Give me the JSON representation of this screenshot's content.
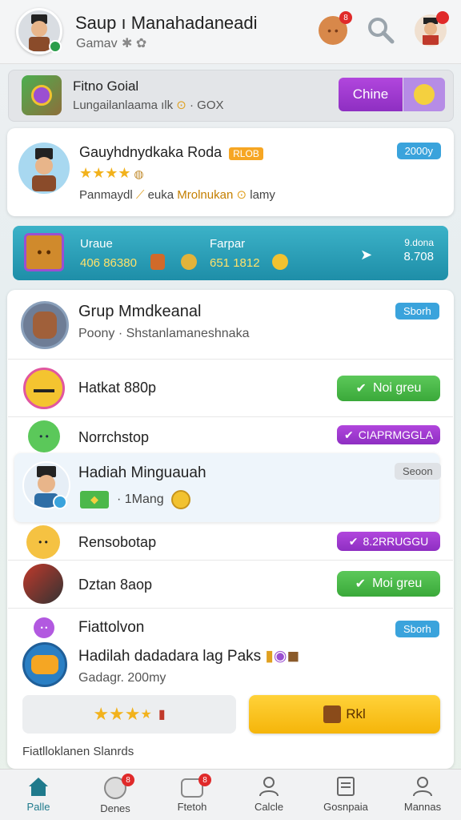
{
  "header": {
    "title": "Saup ı Manahadaneadi",
    "subtitle": "Gamav",
    "colors": {
      "accent": "#2a9d4a",
      "badge": "#e02a2a"
    },
    "notification_count": "8"
  },
  "promo": {
    "title": "Fitno Goial",
    "subtitle": "Lungailanlaama ılk",
    "subtitle_suffix": "· GOX",
    "button_label": "Chine"
  },
  "featured": {
    "title": "Gauyhdnydkaka Roda",
    "tag": "RLOB",
    "badge": "2000y",
    "desc_prefix": "Panmaydl",
    "desc_mid": "euka",
    "desc_highlight": "Mrolnukan",
    "desc_suffix": "lamy"
  },
  "stats": {
    "left_label": "Uraue",
    "left_value": "406 86380",
    "mid_label": "Farpar",
    "mid_value": "651 1812",
    "right_label": "9.dona",
    "right_value": "8.708"
  },
  "group": {
    "title": "Grup Mmdkeanal",
    "subtitle": "Poony · Shstanlamaneshnaka",
    "badge": "Sborh"
  },
  "rows": [
    {
      "label": "Hatkat 880p",
      "action": "Noi greu",
      "type": "green"
    },
    {
      "label": "Norrchstop",
      "action": "CIAPRMGGLA",
      "type": "purple"
    },
    {
      "label": "Hadiah Minguauah",
      "sub": "· 1Mang",
      "badge": "Seoon",
      "type": "highlight"
    },
    {
      "label": "Rensobotap",
      "action": "8.2RRUGGU",
      "type": "purple"
    },
    {
      "label": "Dztan 8aop",
      "action": "Moi greu",
      "type": "green"
    }
  ],
  "bottom_card": {
    "title": "Fiattolvon",
    "badge": "Sborh",
    "pack_title": "Hadilah dadadara lag Paks",
    "pack_sub": "Gadagr. 200my",
    "rate_button": "",
    "cta_label": "Rkl"
  },
  "footer_label": "Fiatlloklanen Slanrds",
  "bottom_nav": [
    {
      "label": "Palle",
      "icon": "home-icon",
      "active": true
    },
    {
      "label": "Denes",
      "icon": "pen-icon",
      "badge": "8"
    },
    {
      "label": "Ftetoh",
      "icon": "chat-icon",
      "badge": "8"
    },
    {
      "label": "Calcle",
      "icon": "user-icon"
    },
    {
      "label": "Gosnpaia",
      "icon": "book-icon"
    },
    {
      "label": "Mannas",
      "icon": "profile-icon"
    }
  ]
}
